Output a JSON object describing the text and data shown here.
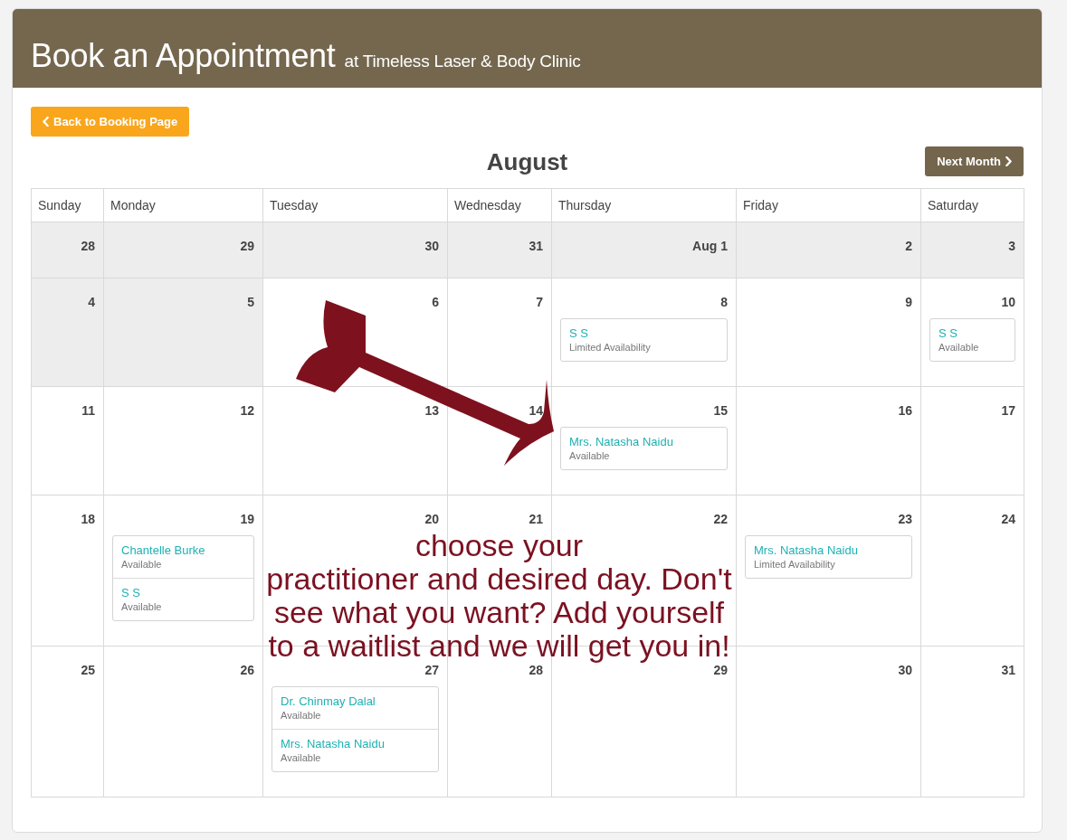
{
  "header": {
    "title": "Book an Appointment",
    "subtitle": "at Timeless Laser & Body Clinic"
  },
  "back_button": {
    "label": "Back to Booking Page"
  },
  "month": {
    "title": "August",
    "next_button": "Next Month"
  },
  "calendar": {
    "columns": [
      "Sunday",
      "Monday",
      "Tuesday",
      "Wednesday",
      "Thursday",
      "Friday",
      "Saturday"
    ],
    "weeks": [
      {
        "days": [
          {
            "date": "28",
            "past": true
          },
          {
            "date": "29",
            "past": true
          },
          {
            "date": "30",
            "past": true
          },
          {
            "date": "31",
            "past": true
          },
          {
            "date": "Aug 1",
            "past": true
          },
          {
            "date": "2",
            "past": true
          },
          {
            "date": "3",
            "past": true
          }
        ]
      },
      {
        "days": [
          {
            "date": "4",
            "past": true
          },
          {
            "date": "5",
            "past": true
          },
          {
            "date": "6",
            "past": false
          },
          {
            "date": "7",
            "past": false
          },
          {
            "date": "8",
            "past": false,
            "slots": [
              {
                "name": "S S",
                "status": "Limited Availability"
              }
            ]
          },
          {
            "date": "9",
            "past": false
          },
          {
            "date": "10",
            "past": false,
            "slots": [
              {
                "name": "S S",
                "status": "Available"
              }
            ]
          }
        ]
      },
      {
        "days": [
          {
            "date": "11",
            "past": false
          },
          {
            "date": "12",
            "past": false
          },
          {
            "date": "13",
            "past": false
          },
          {
            "date": "14",
            "past": false
          },
          {
            "date": "15",
            "past": false,
            "slots": [
              {
                "name": "Mrs. Natasha Naidu",
                "status": "Available"
              }
            ]
          },
          {
            "date": "16",
            "past": false
          },
          {
            "date": "17",
            "past": false
          }
        ]
      },
      {
        "days": [
          {
            "date": "18",
            "past": false
          },
          {
            "date": "19",
            "past": false,
            "slots": [
              {
                "name": "Chantelle Burke",
                "status": "Available"
              },
              {
                "name": "S S",
                "status": "Available"
              }
            ]
          },
          {
            "date": "20",
            "past": false
          },
          {
            "date": "21",
            "past": false
          },
          {
            "date": "22",
            "past": false
          },
          {
            "date": "23",
            "past": false,
            "slots": [
              {
                "name": "Mrs. Natasha Naidu",
                "status": "Limited Availability"
              }
            ]
          },
          {
            "date": "24",
            "past": false
          }
        ]
      },
      {
        "days": [
          {
            "date": "25",
            "past": false
          },
          {
            "date": "26",
            "past": false
          },
          {
            "date": "27",
            "past": false,
            "slots": [
              {
                "name": "Dr. Chinmay Dalal",
                "status": "Available"
              },
              {
                "name": "Mrs. Natasha Naidu",
                "status": "Available"
              }
            ]
          },
          {
            "date": "28",
            "past": false
          },
          {
            "date": "29",
            "past": false
          },
          {
            "date": "30",
            "past": false
          },
          {
            "date": "31",
            "past": false
          }
        ]
      }
    ]
  },
  "annotation": {
    "text": "choose your\npractitioner and desired day. Don't\nsee what you want? Add yourself\nto a waitlist and we will get you in!"
  }
}
